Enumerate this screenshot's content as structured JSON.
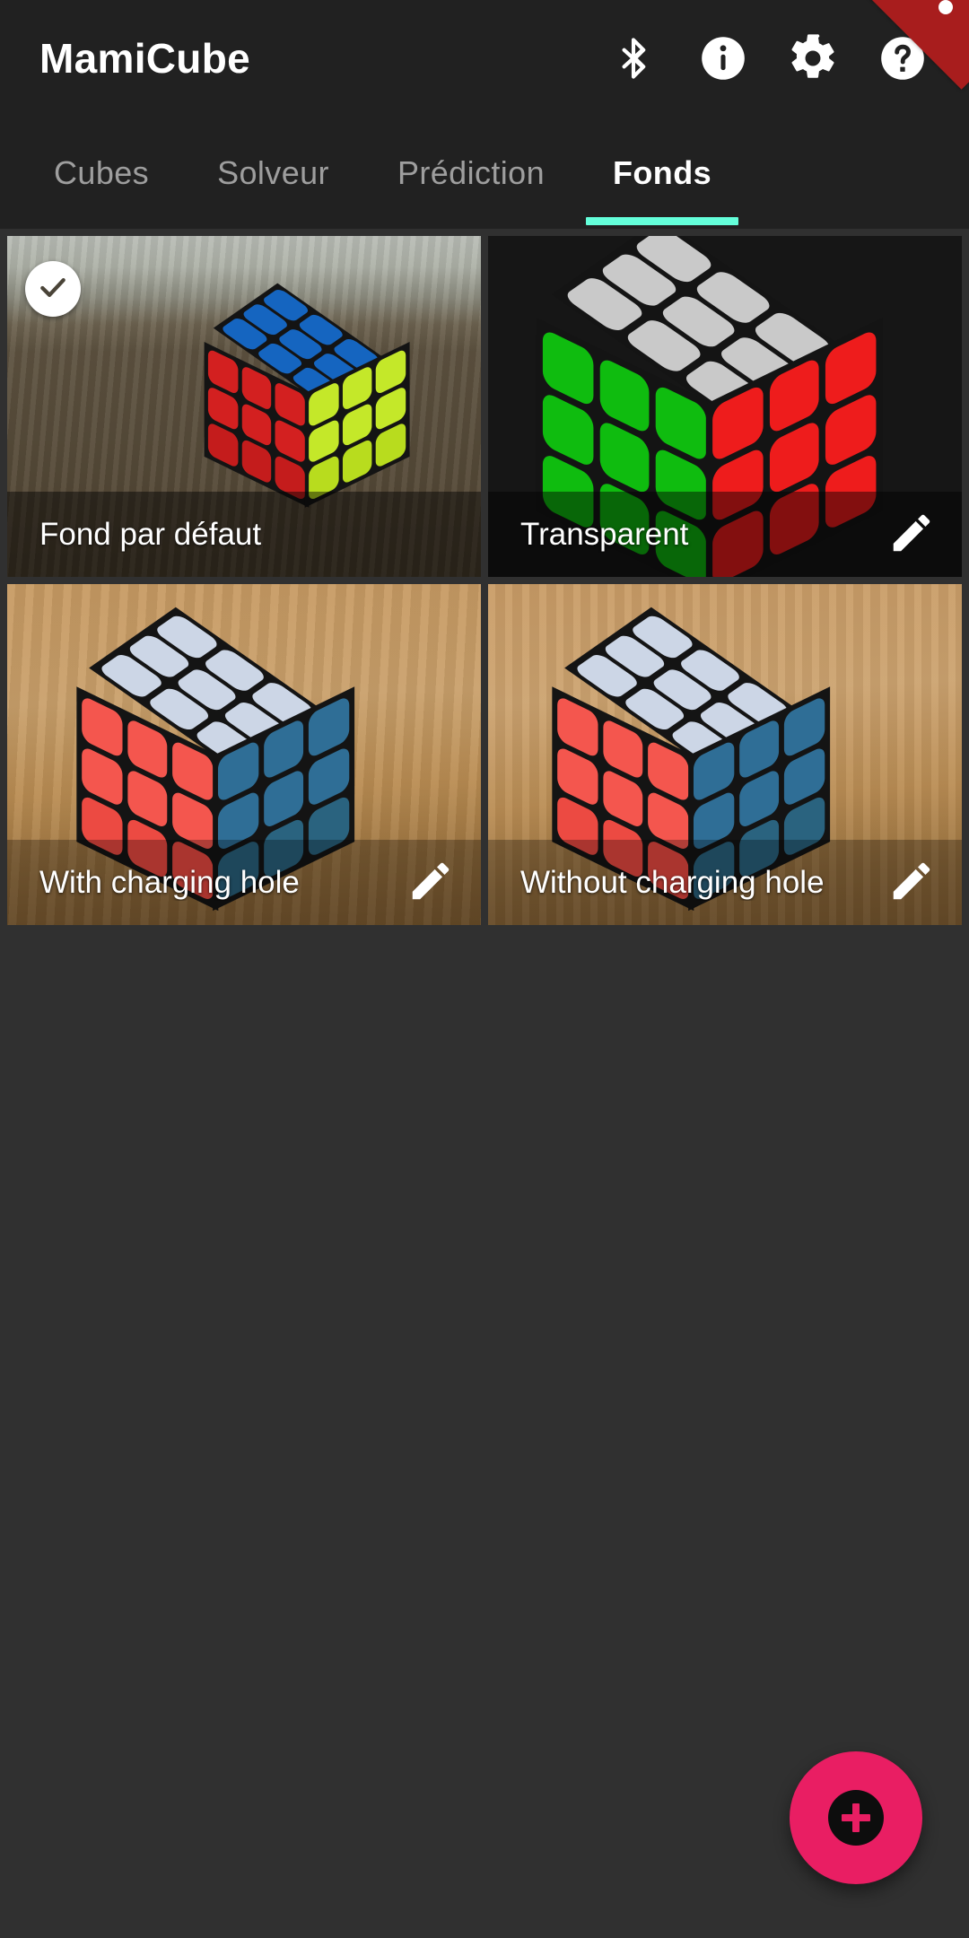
{
  "app": {
    "title": "MamiCube",
    "background_color": "#303030",
    "appbar_color": "#212121",
    "accent_color": "#64ffda",
    "fab_color": "#e91e63",
    "ribbon_color": "#a81d1d"
  },
  "appbar": {
    "title": "MamiCube",
    "actions": [
      {
        "name": "bluetooth-icon",
        "label": "Bluetooth"
      },
      {
        "name": "info-icon",
        "label": "Informations"
      },
      {
        "name": "gear-icon",
        "label": "Paramètres"
      },
      {
        "name": "help-icon",
        "label": "Aide"
      }
    ]
  },
  "tabs": {
    "active_index": 3,
    "items": [
      {
        "label": "Cubes"
      },
      {
        "label": "Solveur"
      },
      {
        "label": "Prédiction"
      },
      {
        "label": "Fonds"
      }
    ]
  },
  "backgrounds": {
    "items": [
      {
        "label": "Fond par défaut",
        "selected": true,
        "editable": false,
        "scene": "default-photo"
      },
      {
        "label": "Transparent",
        "selected": false,
        "editable": true,
        "scene": "transparent-render"
      },
      {
        "label": "With charging hole",
        "selected": false,
        "editable": true,
        "scene": "photo-with-hole"
      },
      {
        "label": "Without charging hole",
        "selected": false,
        "editable": true,
        "scene": "photo-without-hole"
      }
    ]
  },
  "fab": {
    "label": "Ajouter un fond",
    "icon": "plus-icon"
  }
}
